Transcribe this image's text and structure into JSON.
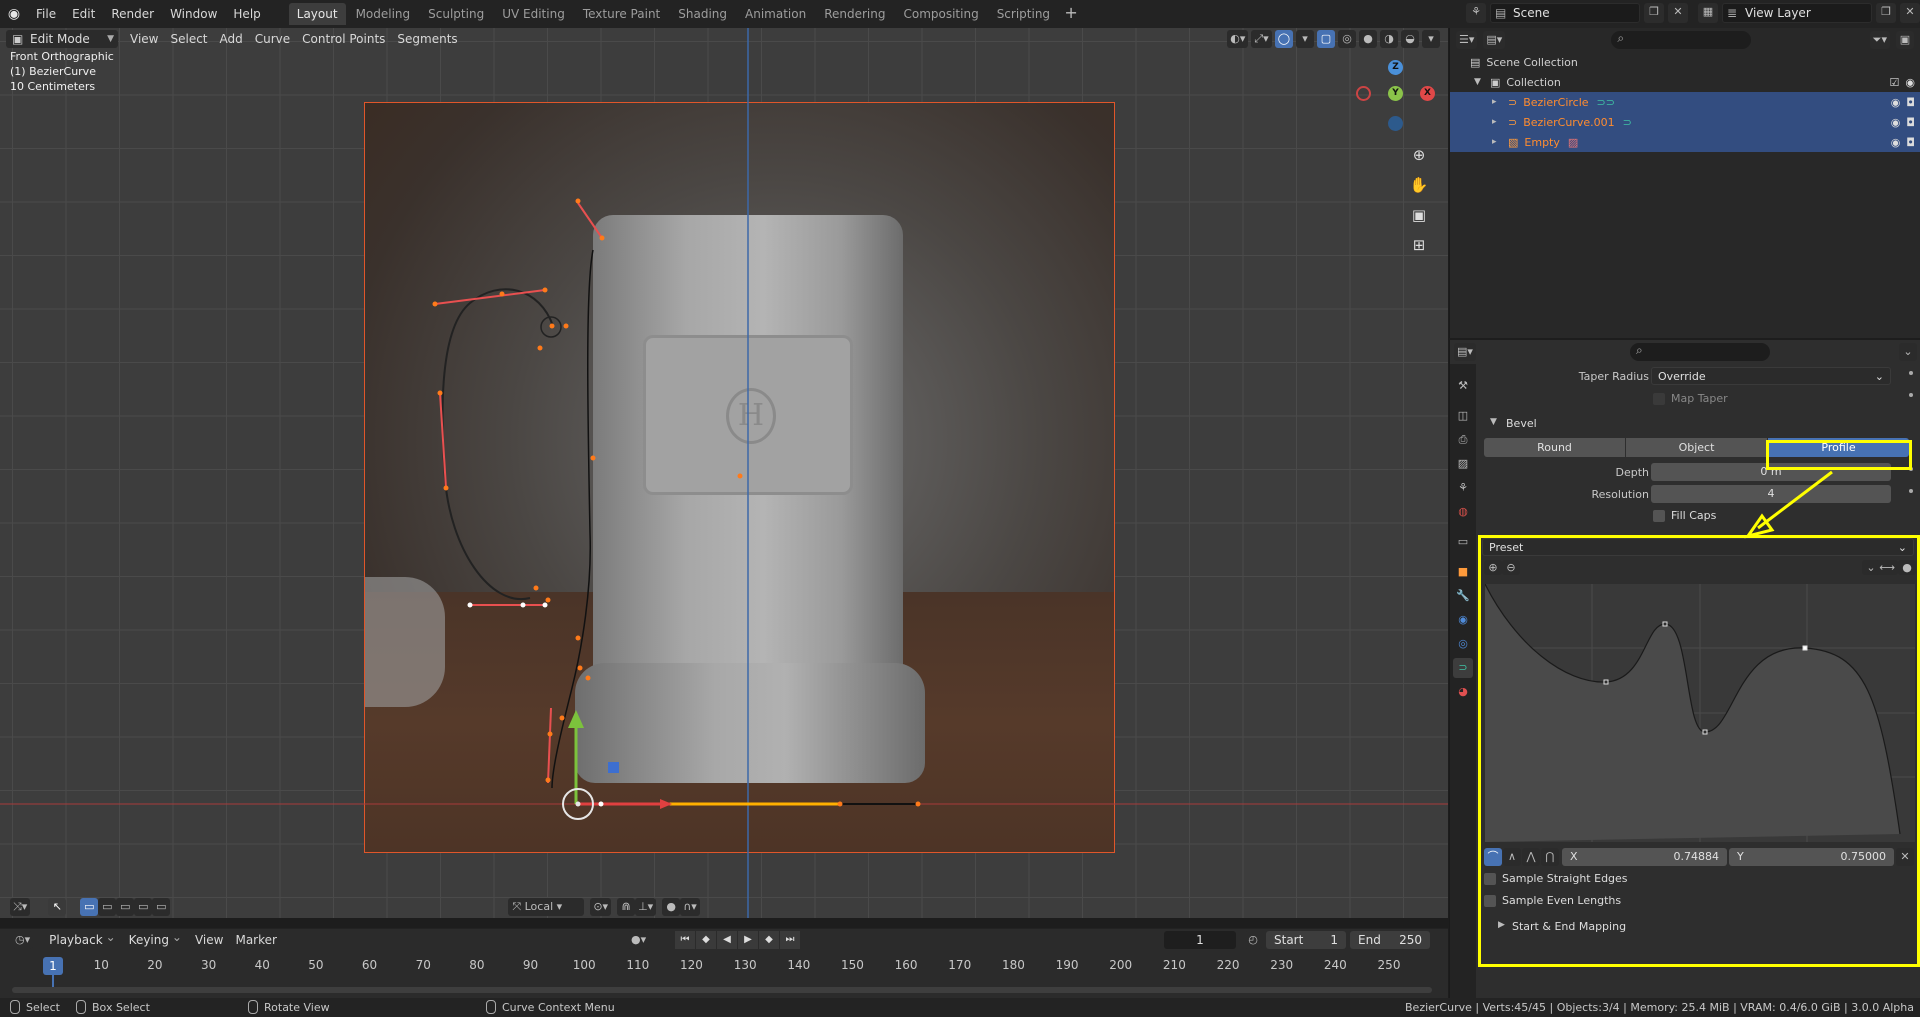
{
  "topbar": {
    "menus": [
      "File",
      "Edit",
      "Render",
      "Window",
      "Help"
    ],
    "workspace_tabs": [
      "Layout",
      "Modeling",
      "Sculpting",
      "UV Editing",
      "Texture Paint",
      "Shading",
      "Animation",
      "Rendering",
      "Compositing",
      "Scripting"
    ],
    "active_tab": "Layout",
    "add_tab_icon": "plus-icon",
    "scene": "Scene",
    "view_layer": "View Layer"
  },
  "viewport": {
    "mode": "Edit Mode",
    "menus": [
      "View",
      "Select",
      "Add",
      "Curve",
      "Control Points",
      "Segments"
    ],
    "info_lines": [
      "Front Orthographic",
      "(1) BezierCurve",
      "10 Centimeters"
    ],
    "gizmo_axes": {
      "x": "X",
      "y": "Y",
      "z": "Z"
    },
    "pivot_label": "Local",
    "colors": {
      "selection_orange": "#e0562a",
      "x_axis": "#c0392b",
      "y_axis": "#8bc34a",
      "z_axis": "#4a90d9"
    }
  },
  "timeline": {
    "menus": [
      "Playback",
      "Keying",
      "View",
      "Marker"
    ],
    "current_frame": "1",
    "start_label": "Start",
    "start": "1",
    "end_label": "End",
    "end": "250",
    "ticks": [
      "10",
      "20",
      "30",
      "40",
      "50",
      "60",
      "70",
      "80",
      "90",
      "100",
      "110",
      "120",
      "130",
      "140",
      "150",
      "160",
      "170",
      "180",
      "190",
      "200",
      "210",
      "220",
      "230",
      "240",
      "250"
    ],
    "marker_frame": "1"
  },
  "statusbar": {
    "select": "Select",
    "box_select": "Box Select",
    "rotate_view": "Rotate View",
    "context_menu": "Curve Context Menu",
    "stats": "BezierCurve | Verts:45/45 | Objects:3/4 | Memory: 25.4 MiB | VRAM: 0.4/6.0 GiB | 3.0.0 Alpha"
  },
  "outliner": {
    "scene_collection": "Scene Collection",
    "collection": "Collection",
    "objects": [
      {
        "name": "BezierCircle",
        "selected": true
      },
      {
        "name": "BezierCurve.001",
        "selected": true
      },
      {
        "name": "Empty",
        "selected": true
      }
    ]
  },
  "properties": {
    "taper_radius_label": "Taper Radius",
    "taper_radius_value": "Override",
    "map_taper_label": "Map Taper",
    "bevel_section": "Bevel",
    "bevel_modes": [
      "Round",
      "Object",
      "Profile"
    ],
    "bevel_active": "Profile",
    "depth_label": "Depth",
    "depth_value": "0 m",
    "resolution_label": "Resolution",
    "resolution_value": "4",
    "fill_caps_label": "Fill Caps",
    "preset_label": "Preset",
    "x_label": "X",
    "x_value": "0.74884",
    "y_label": "Y",
    "y_value": "0.75000",
    "sample_straight_label": "Sample Straight Edges",
    "sample_even_label": "Sample Even Lengths",
    "start_end_label": "Start & End Mapping",
    "highlight_color": "#ffff00"
  }
}
